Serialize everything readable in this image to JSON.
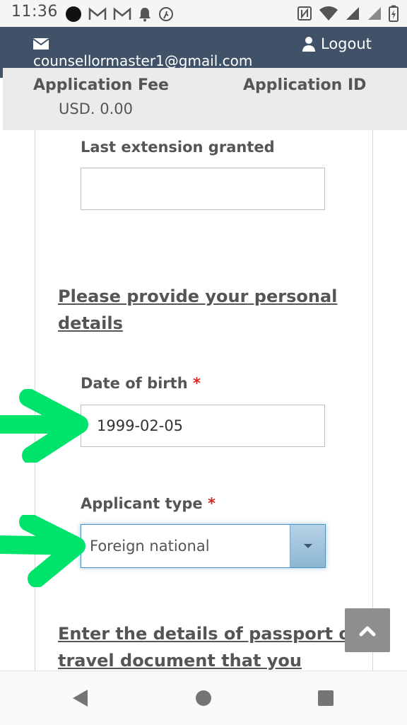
{
  "status_bar": {
    "time": "11:36",
    "left_icons": [
      "dot-icon",
      "gmail-icon",
      "gmail-icon",
      "bell-icon",
      "fitness-icon"
    ],
    "right_icons": [
      "nfc-icon",
      "wifi-icon",
      "signal-icon",
      "signal-icon",
      "battery-icon"
    ]
  },
  "header": {
    "email": "counsellormaster1@gmail.com",
    "logout_label": "Logout",
    "background": "#3f5267"
  },
  "fee_bar": {
    "fee_label": "Application Fee",
    "fee_value": "USD. 0.00",
    "app_id_label": "Application ID"
  },
  "form": {
    "last_extension": {
      "label": "Last extension granted",
      "value": ""
    },
    "personal_heading": "Please provide your personal details",
    "dob": {
      "label": "Date of birth",
      "required_mark": "*",
      "value": "1999-02-05"
    },
    "applicant_type": {
      "label": "Applicant type",
      "required_mark": "*",
      "selected": "Foreign national"
    },
    "passport_heading": "Enter the details of passport or travel document that you"
  },
  "annotations": {
    "arrow_color": "#00e36b"
  },
  "back_to_top_icon": "chevron-up-icon",
  "nav_bar": {
    "icons": [
      "back-icon",
      "home-icon",
      "recents-icon"
    ]
  }
}
